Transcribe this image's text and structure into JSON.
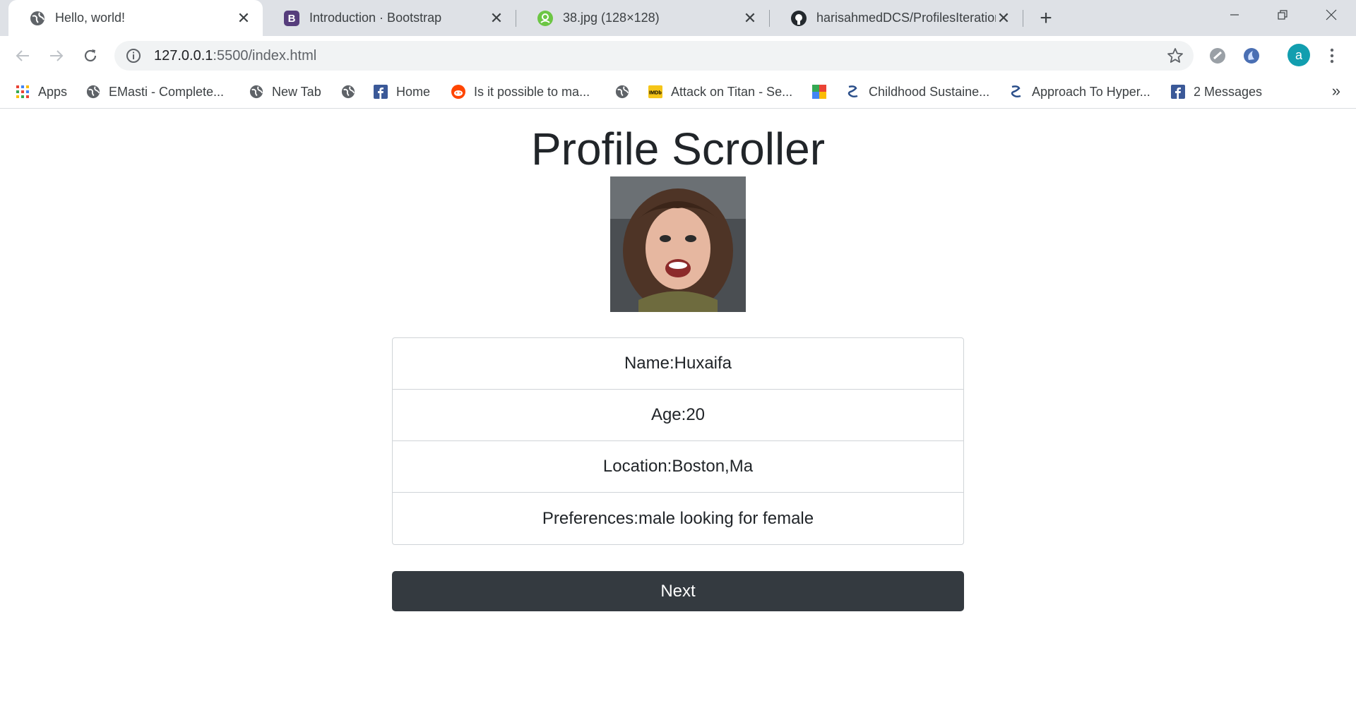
{
  "tabs": [
    {
      "title": "Hello, world!",
      "icon": "globe-icon",
      "active": true
    },
    {
      "title": "Introduction · Bootstrap",
      "icon": "bootstrap-icon",
      "active": false
    },
    {
      "title": "38.jpg (128×128)",
      "icon": "image-viewer-icon",
      "active": false
    },
    {
      "title": "harisahmedDCS/ProfilesIteration",
      "icon": "github-icon",
      "active": false
    }
  ],
  "address_bar": {
    "host": "127.0.0.1",
    "rest": ":5500/index.html"
  },
  "bookmarks": [
    {
      "label": "Apps",
      "icon": "apps-grid-icon"
    },
    {
      "label": "EMasti - Complete...",
      "icon": "globe-icon"
    },
    {
      "label": "New Tab",
      "icon": "globe-icon"
    },
    {
      "label": "",
      "icon": "globe-icon"
    },
    {
      "label": "Home",
      "icon": "facebook-icon"
    },
    {
      "label": "Is it possible to ma...",
      "icon": "reddit-icon"
    },
    {
      "label": "",
      "icon": "globe-icon"
    },
    {
      "label": "Attack on Titan - Se...",
      "icon": "imdb-icon"
    },
    {
      "label": "",
      "icon": "colorful-square-icon"
    },
    {
      "label": "Childhood Sustaine...",
      "icon": "link-chain-icon"
    },
    {
      "label": "Approach To Hyper...",
      "icon": "link-chain-icon"
    },
    {
      "label": "2 Messages",
      "icon": "facebook-icon"
    }
  ],
  "bookmarks_more": "»",
  "account_initial": "a",
  "page": {
    "title": "Profile Scroller",
    "profile": {
      "name": "Name:Huxaifa",
      "age": "Age:20",
      "location": "Location:Boston,Ma",
      "preferences": "Preferences:male looking for female"
    },
    "next_label": "Next"
  },
  "colors": {
    "button_bg": "#343a40",
    "tab_strip": "#dee1e6",
    "avatar": "#129eaf"
  }
}
